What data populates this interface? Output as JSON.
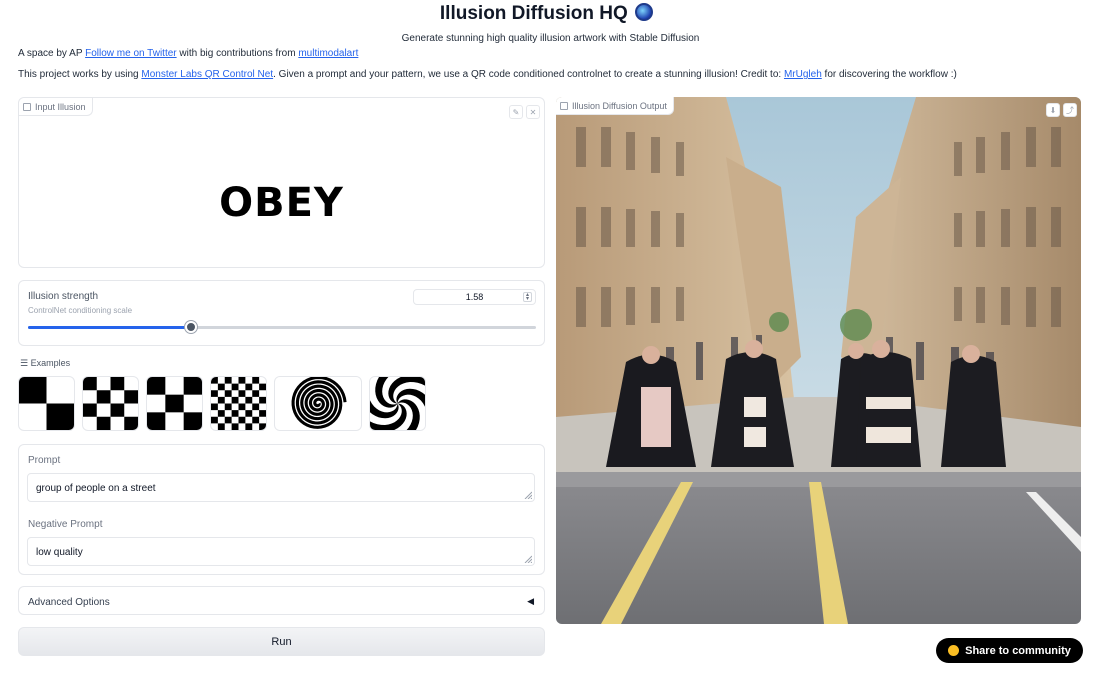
{
  "header": {
    "title": "Illusion Diffusion HQ",
    "subtitle": "Generate stunning high quality illusion artwork with Stable Diffusion",
    "credit_prefix": "A space by AP ",
    "credit_link1": "Follow me on Twitter",
    "credit_mid": " with big contributions from ",
    "credit_link2": "multimodalart",
    "desc_prefix": "This project works by using ",
    "desc_link1": "Monster Labs QR Control Net",
    "desc_mid": ". Given a prompt and your pattern, we use a QR code conditioned controlnet to create a stunning illusion! Credit to: ",
    "desc_link2": "MrUgleh",
    "desc_suffix": " for discovering the workflow :)"
  },
  "input_panel": {
    "label": "Input Illusion",
    "image_text": "OBEY",
    "edit_icon": "pencil-icon",
    "clear_icon": "close-icon"
  },
  "strength": {
    "label": "Illusion strength",
    "info": "ControlNet conditioning scale",
    "value": "1.58",
    "fraction": 0.32
  },
  "examples": {
    "label": "Examples",
    "items": [
      "checker-2x2",
      "checker-4x4",
      "checker-3x3",
      "checker-8x8",
      "spiral",
      "swirl"
    ]
  },
  "prompt": {
    "label": "Prompt",
    "value": "group of people on a street"
  },
  "negative_prompt": {
    "label": "Negative Prompt",
    "value": "low quality"
  },
  "advanced": {
    "label": "Advanced Options",
    "caret": "◀"
  },
  "run_button": {
    "label": "Run"
  },
  "output": {
    "label": "Illusion Diffusion Output",
    "download_icon": "download-icon",
    "share_icon": "share-icon"
  },
  "share_button": {
    "label": "Share to community"
  },
  "colors": {
    "accent": "#2563eb",
    "slider_thumb": "#4b5563"
  }
}
